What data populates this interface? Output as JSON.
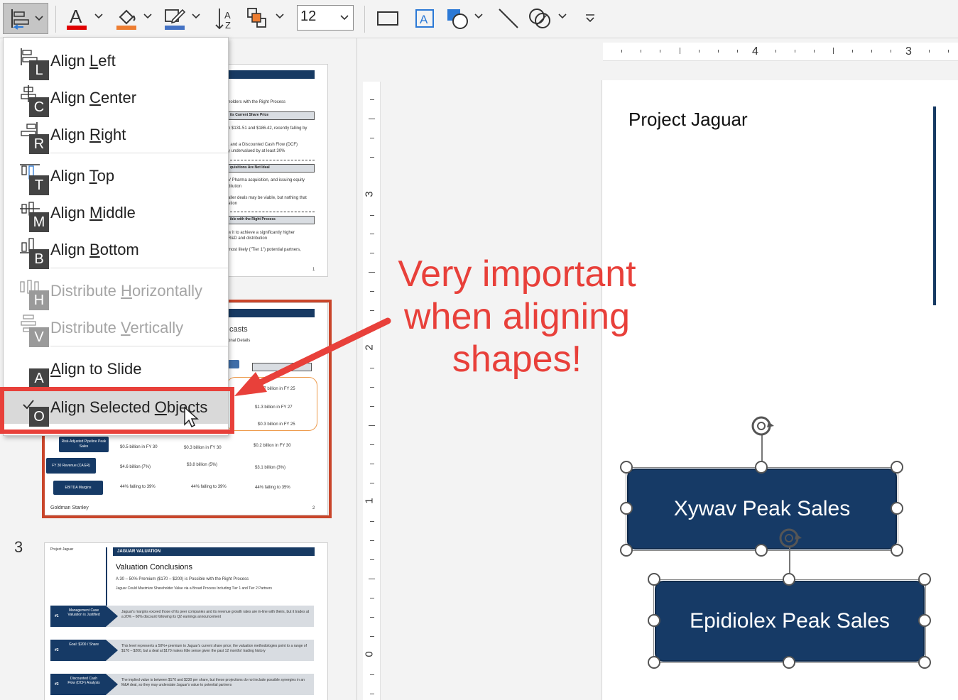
{
  "ribbon": {
    "font_size": "12",
    "icons": [
      "align-objects-icon",
      "font-color-icon",
      "shape-fill-icon",
      "shape-outline-icon",
      "text-direction-icon",
      "arrange-icon",
      "rectangle-icon",
      "text-box-icon",
      "shapes-icon",
      "line-icon",
      "merge-shapes-icon",
      "more-options-icon"
    ],
    "colors": {
      "font_color": "#e00000",
      "fill_color": "#ed7d31",
      "outline_color": "#4472c4"
    }
  },
  "menu": {
    "items": [
      {
        "label": "Align Left",
        "key": "L"
      },
      {
        "label": "Align Center",
        "key": "C"
      },
      {
        "label": "Align Right",
        "key": "R"
      },
      {
        "label": "Align Top",
        "key": "T"
      },
      {
        "label": "Align Middle",
        "key": "M"
      },
      {
        "label": "Align Bottom",
        "key": "B"
      },
      {
        "label": "Distribute Horizontally",
        "key": "H"
      },
      {
        "label": "Distribute Vertically",
        "key": "V"
      },
      {
        "label": "Align to Slide",
        "key": "A"
      },
      {
        "label": "Align Selected Objects",
        "key": "O"
      }
    ]
  },
  "thumbnails": {
    "slide3_number": "3",
    "slide1": {
      "lines": [
        "holders with the Right Process",
        "its Current Share Price",
        "n $131.51 and $186.42, recently falling by",
        ", and a Discounted Cash Flow (DCF)",
        "y undervalued by at least 30%",
        "quisitions Are Not Ideal",
        "V Pharma acquisition, and issuing equity",
        "dilution",
        "aller deals may be viable, but nothing that",
        "ation",
        "ible with the Right Process",
        "w it to achieve a significantly higher",
        "R&D and distribution",
        "most likely (\"Tier 1\") potential partners,",
        "1"
      ]
    },
    "slide2": {
      "lines": [
        "casts",
        "onal Details",
        "$0.7 billion in FY 25",
        "$1.3 billion in FY 27",
        "$0.3 billion in FY 25",
        "Risk-Adjusted Pipeline Peak Sales",
        "$0.5 billion in FY 30",
        "$0.3 billion in FY 30",
        "$0.2 billion in FY 30",
        "FY 30 Revenue (CAGR)",
        "$4.6 billion (7%)",
        "$3.8 billion (5%)",
        "$3.1 billion (3%)",
        "EBITDA Margins",
        "44% falling to 39%",
        "44% falling to 39%",
        "44% falling to 35%",
        "Goldman Stanley",
        "2"
      ]
    },
    "slide3": {
      "project": "Project Jaguar",
      "header": "JAGUAR VALUATION",
      "title": "Valuation Conclusions",
      "subtitle": "A 30 – 50% Premium ($170 – $200) is Possible with the Right Process",
      "subtitle2": "Jaguar Could Maximize Shareholder Value via a Broad Process Including Tier 1 and Tier 2 Partners",
      "rows": [
        {
          "num": "#1",
          "label": "Management Case Valuation is Justified",
          "text": "Jaguar's margins exceed those of its peer companies and its revenue growth rates are in-line with theirs, but it trades at a 20% – 60% discount following its Q2 earnings announcement"
        },
        {
          "num": "#2",
          "label": "Goal: $200 / Share",
          "text": "This level represents a 50%+ premium to Jaguar's current share price; the valuation methodologies point to a range of $170 – $200, but a deal at $170 makes little sense given the past 12 months' trading history"
        },
        {
          "num": "#3",
          "label": "Discounted Cash Flow (DCF) Analysis",
          "text": "The implied value is between $170 and $230 per share, but these projections do not include possible synergies in an M&A deal, so they may understate Jaguar's value to potential partners"
        }
      ]
    }
  },
  "rulers": {
    "horizontal": [
      "4",
      "3"
    ],
    "vertical": [
      "3",
      "2",
      "1",
      "0"
    ]
  },
  "slide": {
    "title": "Project Jaguar",
    "shape1": "Xywav Peak Sales",
    "shape2": "Epidiolex Peak Sales",
    "shape_color": "#163a66"
  },
  "annotation": {
    "line1": "Very important",
    "line2": "when aligning",
    "line3": "shapes!",
    "color": "#e8403a"
  }
}
